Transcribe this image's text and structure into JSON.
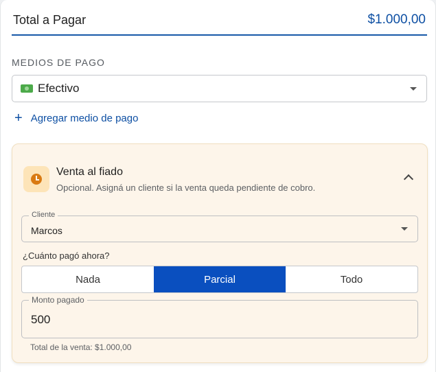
{
  "total": {
    "label": "Total a Pagar",
    "amount": "$1.000,00"
  },
  "payment_methods": {
    "title": "MEDIOS DE PAGO",
    "selected": "Efectivo",
    "selected_icon": "money-bill-icon",
    "add_label": "Agregar medio de pago"
  },
  "fiado": {
    "title": "Venta al fiado",
    "subtitle": "Opcional. Asigná un cliente si la venta queda pendiente de cobro.",
    "client_label": "Cliente",
    "client_value": "Marcos",
    "question": "¿Cuánto pagó ahora?",
    "options": [
      "Nada",
      "Parcial",
      "Todo"
    ],
    "selected_option": "Parcial",
    "amount_label": "Monto pagado",
    "amount_value": "500",
    "helper": "Total de la venta: $1.000,00"
  },
  "colors": {
    "accent": "#0d4fa3",
    "toggle_active": "#0a4fbf",
    "fiado_bg": "#fdf5ea",
    "clock": "#d97a12"
  }
}
